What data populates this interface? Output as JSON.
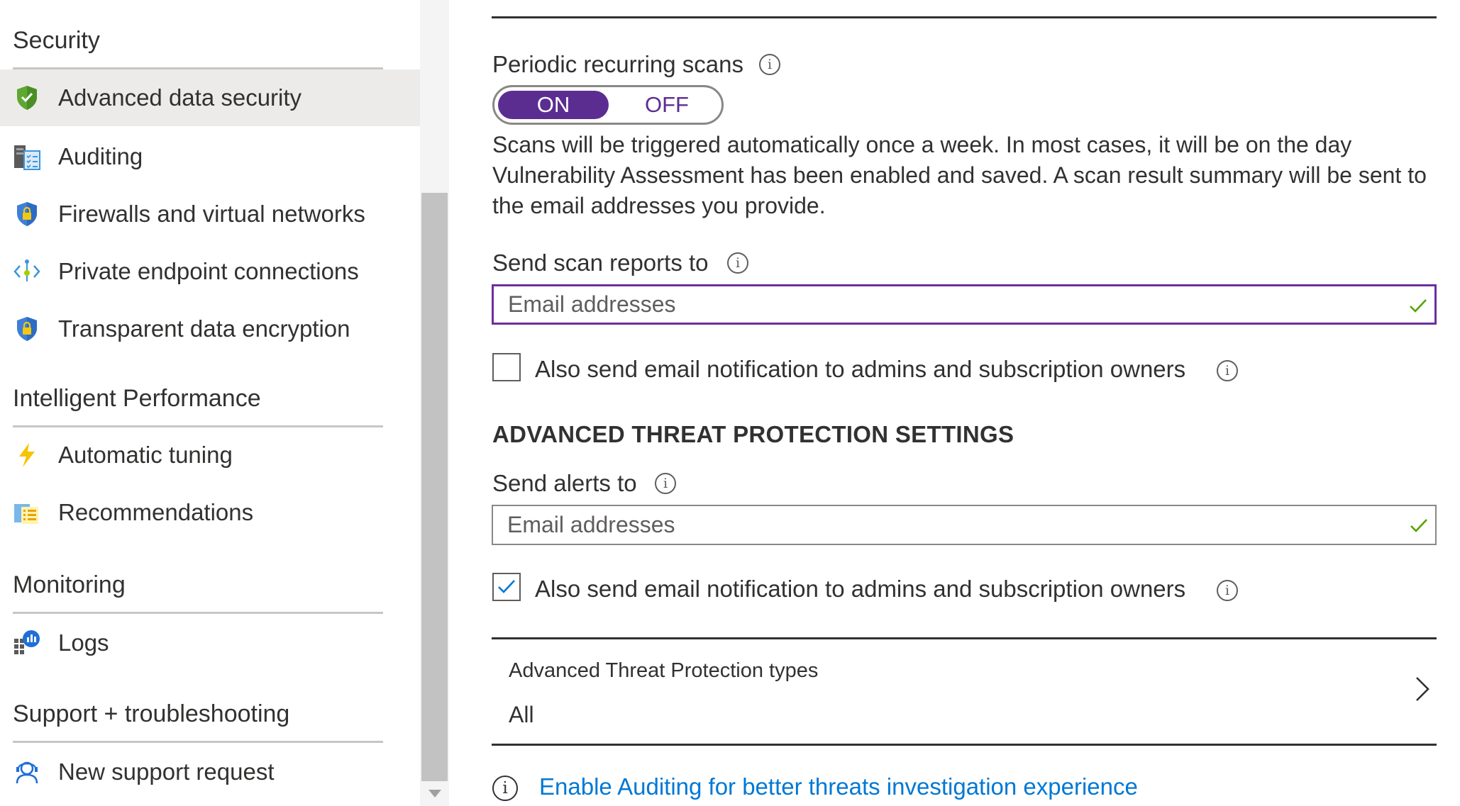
{
  "sidebar": {
    "sections": [
      {
        "title": "Security",
        "items": [
          {
            "label": "Advanced data security",
            "icon": "shield-check-icon"
          },
          {
            "label": "Auditing",
            "icon": "auditing-icon"
          },
          {
            "label": "Firewalls and virtual networks",
            "icon": "shield-lock-icon"
          },
          {
            "label": "Private endpoint connections",
            "icon": "private-endpoint-icon"
          },
          {
            "label": "Transparent data encryption",
            "icon": "shield-lock-icon"
          }
        ]
      },
      {
        "title": "Intelligent Performance",
        "items": [
          {
            "label": "Automatic tuning",
            "icon": "lightning-icon"
          },
          {
            "label": "Recommendations",
            "icon": "recommendations-icon"
          }
        ]
      },
      {
        "title": "Monitoring",
        "items": [
          {
            "label": "Logs",
            "icon": "logs-icon"
          }
        ]
      },
      {
        "title": "Support + troubleshooting",
        "items": [
          {
            "label": "New support request",
            "icon": "support-person-icon"
          }
        ]
      }
    ],
    "selected_item": "Advanced data security"
  },
  "main": {
    "periodic_scans": {
      "label": "Periodic recurring scans",
      "toggle_on": "ON",
      "toggle_off": "OFF",
      "state": "ON",
      "description": "Scans will be triggered automatically once a week. In most cases, it will be on the day Vulnerability Assessment has been enabled and saved. A scan result summary will be sent to the email addresses you provide."
    },
    "scan_reports": {
      "label": "Send scan reports to",
      "placeholder": "Email addresses",
      "value": "",
      "notify_admins_label": "Also send email notification to admins and subscription owners",
      "notify_admins_checked": false
    },
    "atp_heading": "ADVANCED THREAT PROTECTION SETTINGS",
    "alerts": {
      "label": "Send alerts to",
      "placeholder": "Email addresses",
      "value": "",
      "notify_admins_label": "Also send email notification to admins and subscription owners",
      "notify_admins_checked": true
    },
    "atp_types": {
      "title": "Advanced Threat Protection types",
      "value": "All"
    },
    "auditing_link": "Enable Auditing for better threats investigation experience"
  },
  "colors": {
    "accent_purple": "#5c2d91",
    "focus_border": "#6b2fa0",
    "link_blue": "#0078d4",
    "valid_check": "#57a300",
    "selected_bg": "#edebe9"
  }
}
